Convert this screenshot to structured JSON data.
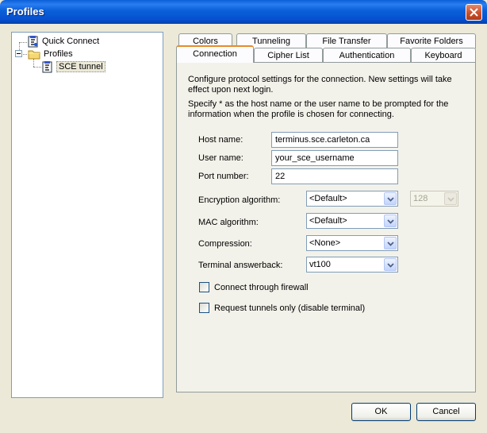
{
  "window": {
    "title": "Profiles"
  },
  "tree": {
    "items": [
      {
        "label": "Quick Connect",
        "icon": "quick-connect-icon"
      },
      {
        "label": "Profiles",
        "icon": "folder-icon"
      },
      {
        "label": "SCE tunnel",
        "icon": "profile-icon",
        "selected": true
      }
    ]
  },
  "tabs": {
    "row1": [
      "Colors",
      "Tunneling",
      "File Transfer",
      "Favorite Folders"
    ],
    "row2": [
      "Connection",
      "Cipher List",
      "Authentication",
      "Keyboard"
    ],
    "active": "Connection"
  },
  "connection": {
    "desc1": "Configure protocol settings for the connection. New settings will take effect upon next login.",
    "desc2": "Specify * as the host name or the user name to be prompted for the information when the profile is chosen for connecting.",
    "host_label": "Host name:",
    "host_value": "terminus.sce.carleton.ca",
    "user_label": "User name:",
    "user_value": "your_sce_username",
    "port_label": "Port number:",
    "port_value": "22",
    "enc_label": "Encryption algorithm:",
    "enc_value": "<Default>",
    "keylen_value": "128",
    "mac_label": "MAC algorithm:",
    "mac_value": "<Default>",
    "comp_label": "Compression:",
    "comp_value": "<None>",
    "term_label": "Terminal answerback:",
    "term_value": "vt100",
    "firewall_label": "Connect through firewall",
    "tunnels_label": "Request tunnels only (disable terminal)"
  },
  "buttons": {
    "ok": "OK",
    "cancel": "Cancel"
  }
}
